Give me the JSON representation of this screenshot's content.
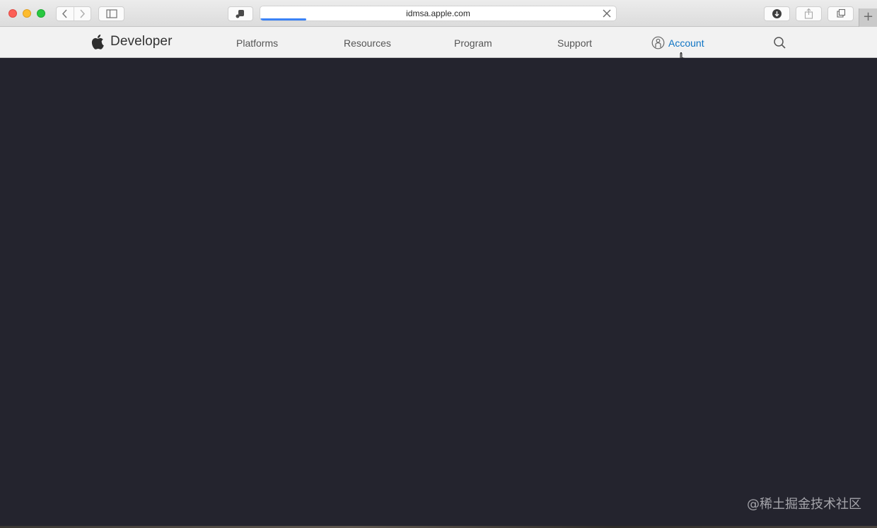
{
  "browser": {
    "url": "idmsa.apple.com",
    "load_progress": 0.13,
    "new_tab_label": "+"
  },
  "site": {
    "brand": "Developer",
    "nav": [
      {
        "label": "Platforms"
      },
      {
        "label": "Resources"
      },
      {
        "label": "Program"
      },
      {
        "label": "Support"
      },
      {
        "label": "Account"
      }
    ]
  },
  "colors": {
    "content_bg": "#24242e",
    "account_link": "#0e74c4",
    "progress": "#3b82f6"
  },
  "watermark": "@稀土掘金技术社区"
}
